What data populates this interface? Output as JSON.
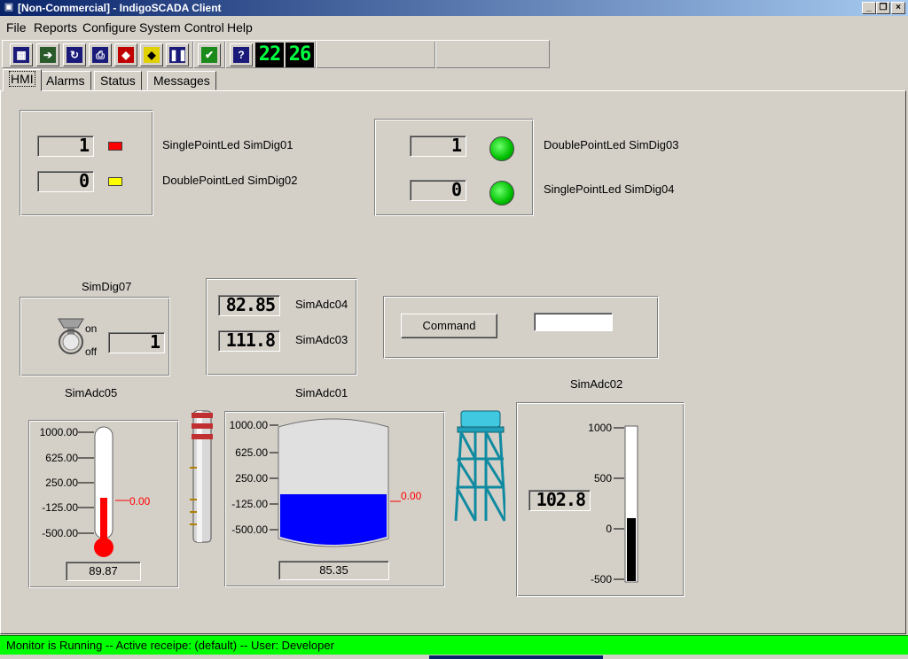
{
  "window": {
    "title": "[Non-Commercial] - IndigoSCADA Client"
  },
  "menu": {
    "items": [
      "File",
      "Reports",
      "Configure",
      "System Control",
      "Help"
    ]
  },
  "toolbar": {
    "buttons": [
      "report-icon",
      "export-icon",
      "import-icon",
      "print-icon",
      "alarm-icon",
      "acknowledge-icon",
      "pause-icon",
      "check-icon",
      "help-icon"
    ],
    "clock_hours": "22",
    "clock_minutes": "26"
  },
  "tabs": [
    "HMI",
    "Alarms",
    "Status",
    "Messages"
  ],
  "hmi": {
    "group1": {
      "row1": {
        "value": "1",
        "label": "SinglePointLed SimDig01",
        "led_color": "#ff0000"
      },
      "row2": {
        "value": "0",
        "label": "DoublePointLed SimDig02",
        "led_color": "#ffff00"
      }
    },
    "group2": {
      "row1": {
        "value": "1",
        "label": "DoublePointLed SimDig03",
        "led_color": "#00cc00"
      },
      "row2": {
        "value": "0",
        "label": "SinglePointLed SimDig04",
        "led_color": "#00cc00"
      }
    },
    "switch": {
      "title": "SimDig07",
      "on_label": "on",
      "off_label": "off",
      "value": "1"
    },
    "adc_group": {
      "row1": {
        "value": "82.85",
        "label": "SimAdc04"
      },
      "row2": {
        "value": "111.8",
        "label": "SimAdc03"
      }
    },
    "command": {
      "button_label": "Command",
      "input_value": ""
    },
    "thermometer": {
      "title": "SimAdc05",
      "ticks": [
        "1000.00",
        "625.00",
        "250.00",
        "-125.00",
        "-500.00"
      ],
      "setpoint_label": "0.00",
      "value": "89.87"
    },
    "tank": {
      "title": "SimAdc01",
      "ticks": [
        "1000.00",
        "625.00",
        "250.00",
        "-125.00",
        "-500.00"
      ],
      "setpoint_label": "0.00",
      "value": "85.35",
      "fill_color": "#0000ff"
    },
    "bargauge": {
      "title": "SimAdc02",
      "ticks": [
        "1000",
        "500",
        "0",
        "-500"
      ],
      "value": "102.8"
    }
  },
  "status": {
    "text": "Monitor is Running -- Active receipe: (default) -- User: Developer",
    "color": "#00ff00"
  }
}
